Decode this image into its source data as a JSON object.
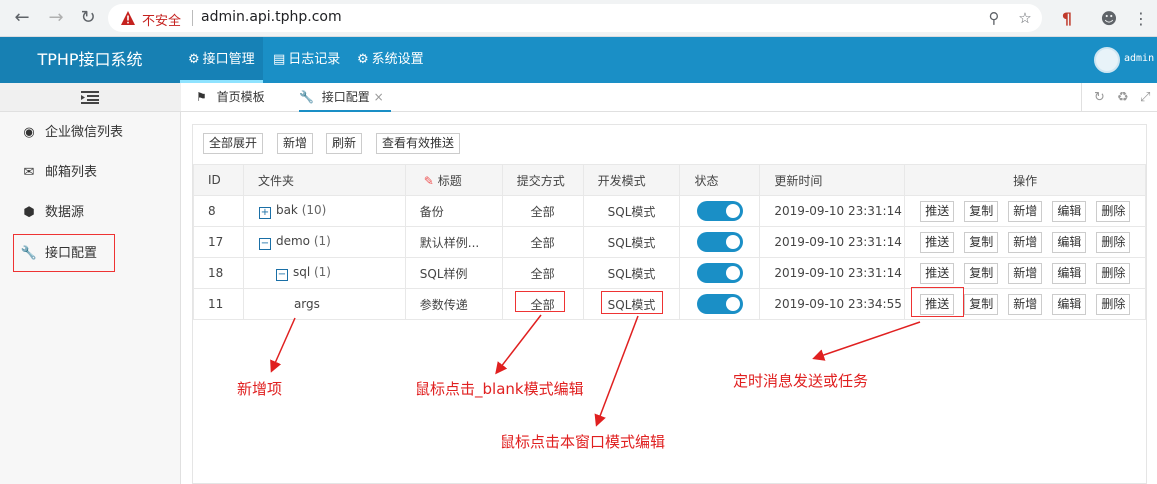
{
  "browser": {
    "security_label": "不安全",
    "url": "admin.api.tphp.com"
  },
  "header": {
    "brand": "TPHP接口系统",
    "nav": [
      {
        "label": "接口管理",
        "icon": "gears-icon"
      },
      {
        "label": "日志记录",
        "icon": "file-icon"
      },
      {
        "label": "系统设置",
        "icon": "gear-icon"
      }
    ],
    "user": "admin"
  },
  "sidebar": {
    "items": [
      {
        "label": "企业微信列表",
        "icon": "wechat-icon"
      },
      {
        "label": "邮箱列表",
        "icon": "envelope-icon"
      },
      {
        "label": "数据源",
        "icon": "cube-icon"
      },
      {
        "label": "接口配置",
        "icon": "wrench-icon"
      }
    ]
  },
  "tabs": [
    {
      "label": "首页模板",
      "icon": "flag-icon"
    },
    {
      "label": "接口配置",
      "icon": "wrench-icon",
      "close": "×"
    }
  ],
  "toolbar": {
    "expand_all": "全部展开",
    "add": "新增",
    "refresh": "刷新",
    "view_valid_push": "查看有效推送"
  },
  "table": {
    "headers": [
      "ID",
      "文件夹",
      "标题",
      "提交方式",
      "开发模式",
      "状态",
      "更新时间",
      "操作"
    ],
    "rows": [
      {
        "id": "8",
        "folder": "bak",
        "count": "(10)",
        "tree": "+",
        "title": "备份",
        "submit": "全部",
        "mode": "SQL模式",
        "status": true,
        "updated": "2019-09-10 23:31:14"
      },
      {
        "id": "17",
        "folder": "demo",
        "count": "(1)",
        "tree": "−",
        "title": "默认样例...",
        "submit": "全部",
        "mode": "SQL模式",
        "status": true,
        "updated": "2019-09-10 23:31:14"
      },
      {
        "id": "18",
        "folder": "sql",
        "count": "(1)",
        "tree": "−",
        "title": "SQL样例",
        "submit": "全部",
        "mode": "SQL模式",
        "status": true,
        "updated": "2019-09-10 23:31:14"
      },
      {
        "id": "11",
        "folder": "args",
        "count": "",
        "tree": "",
        "title": "参数传递",
        "submit": "全部",
        "mode": "SQL模式",
        "status": true,
        "updated": "2019-09-10 23:34:55"
      }
    ],
    "actions": [
      "推送",
      "复制",
      "新增",
      "编辑",
      "删除"
    ]
  },
  "annotations": {
    "new_item": "新增项",
    "blank_edit": "鼠标点击_blank模式编辑",
    "window_edit": "鼠标点击本窗口模式编辑",
    "timed_push": "定时消息发送或任务"
  },
  "colors": {
    "header": "#1a8fc6",
    "brand_bg": "#1780b3",
    "accent_green": "#2e8b1e",
    "annotation_red": "#e02020"
  }
}
